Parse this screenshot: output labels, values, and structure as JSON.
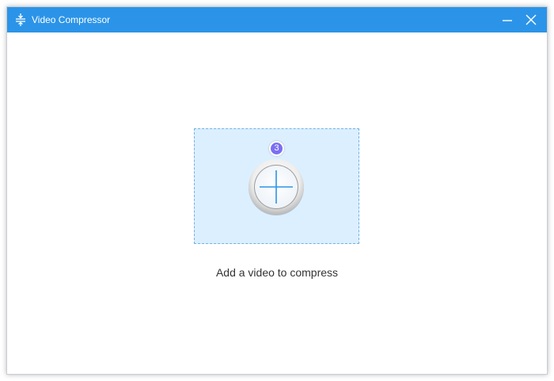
{
  "window": {
    "title": "Video Compressor",
    "app_icon": "compress-icon",
    "controls": {
      "minimize_icon": "minimize-icon",
      "close_icon": "close-icon"
    }
  },
  "main": {
    "drop_zone": {
      "icon": "plus-icon",
      "step_badge": "3"
    },
    "hint": "Add a video to compress"
  },
  "colors": {
    "titlebar": "#2b94e8",
    "drop_zone_bg": "#dcefff",
    "drop_zone_border": "#6eb3e6",
    "plus_icon": "#2b94e8",
    "badge": "#7b6ef2"
  }
}
